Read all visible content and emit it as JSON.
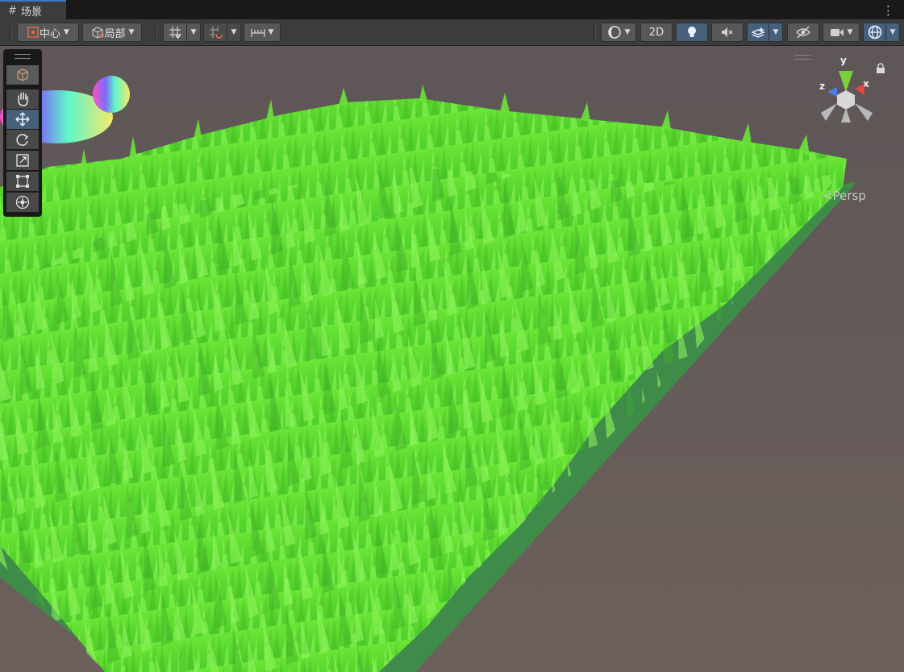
{
  "tab": {
    "icon": "scene-grid-icon",
    "title": "场景"
  },
  "menu": {
    "icon": "kebab-menu-icon",
    "label": "⋮"
  },
  "toolbar": {
    "pivot_label": "中心",
    "rotation_label": "局部",
    "mode_2d_label": "2D",
    "icons": [
      "grid-snap-icon",
      "incremental-snap-icon",
      "ruler-icon",
      "shading-mode-icon",
      "lighting-icon",
      "audio-mute-icon",
      "effects-icon",
      "scene-visibility-icon",
      "camera-icon",
      "gizmos-icon"
    ]
  },
  "tools": [
    {
      "name": "view-tool",
      "icon": "hand-icon"
    },
    {
      "name": "move-tool",
      "icon": "move-arrows-icon",
      "selected": true
    },
    {
      "name": "rotate-tool",
      "icon": "rotate-icon"
    },
    {
      "name": "scale-tool",
      "icon": "scale-icon"
    },
    {
      "name": "rect-tool",
      "icon": "rect-icon"
    },
    {
      "name": "transform-tool",
      "icon": "transform-icon"
    }
  ],
  "gizmo": {
    "y_label": "y",
    "x_label": "x",
    "z_label": "z",
    "projection_label": "Persp"
  },
  "colors": {
    "accent": "#3a79bb",
    "grass": "#5ee032",
    "ground": "#3f8c4a",
    "viewport_bg": "#6b5f5b",
    "selected_bg": "#46607c"
  }
}
